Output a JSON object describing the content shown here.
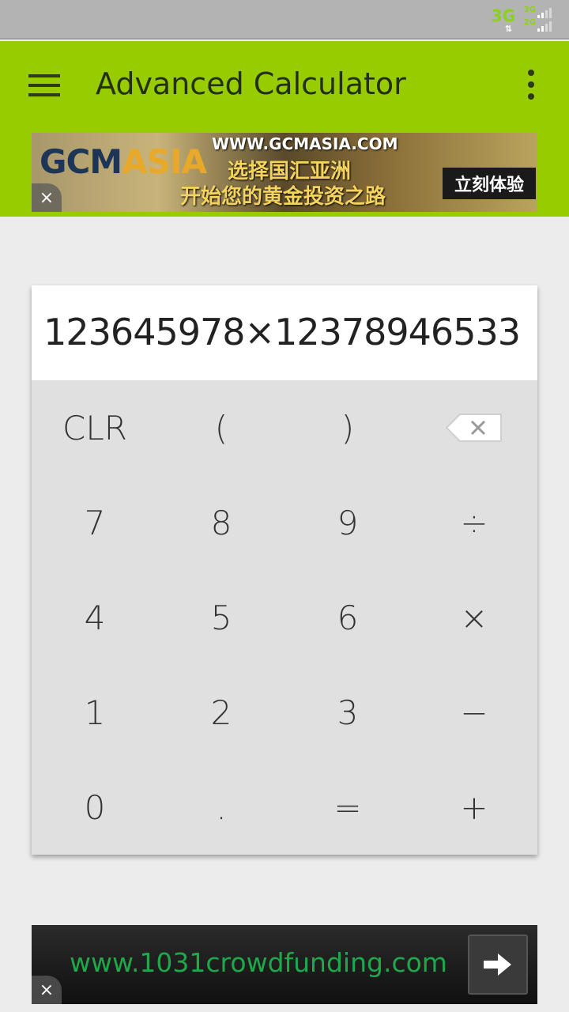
{
  "status_bar": {
    "network_main": "3G",
    "network_sub_top": "3G",
    "network_sub_bottom": "2G",
    "data_arrows": "⇅"
  },
  "app_bar": {
    "title": "Advanced Calculator",
    "menu_icon": "hamburger-menu-icon",
    "overflow_icon": "overflow-menu-icon"
  },
  "ad_top": {
    "logo_gcm": "GCM",
    "logo_asia": "ASIA",
    "url": "WWW.GCMASIA.COM",
    "line1": "选择国汇亚洲",
    "line2": "开始您的黄金投资之路",
    "cta": "立刻体验",
    "close": "×"
  },
  "calculator": {
    "display": "123645978×12378946533",
    "keys": [
      {
        "label": "CLR",
        "name": "clear-button"
      },
      {
        "label": "(",
        "name": "open-paren-button"
      },
      {
        "label": ")",
        "name": "close-paren-button"
      },
      {
        "label": "",
        "name": "backspace-button"
      },
      {
        "label": "7",
        "name": "digit-7-button"
      },
      {
        "label": "8",
        "name": "digit-8-button"
      },
      {
        "label": "9",
        "name": "digit-9-button"
      },
      {
        "label": "÷",
        "name": "divide-button"
      },
      {
        "label": "4",
        "name": "digit-4-button"
      },
      {
        "label": "5",
        "name": "digit-5-button"
      },
      {
        "label": "6",
        "name": "digit-6-button"
      },
      {
        "label": "×",
        "name": "multiply-button"
      },
      {
        "label": "1",
        "name": "digit-1-button"
      },
      {
        "label": "2",
        "name": "digit-2-button"
      },
      {
        "label": "3",
        "name": "digit-3-button"
      },
      {
        "label": "−",
        "name": "subtract-button"
      },
      {
        "label": "0",
        "name": "digit-0-button"
      },
      {
        "label": ".",
        "name": "decimal-button"
      },
      {
        "label": "=",
        "name": "equals-button"
      },
      {
        "label": "+",
        "name": "add-button"
      }
    ]
  },
  "ad_bottom": {
    "text": "www.1031crowdfunding.com",
    "close": "×",
    "arrow_icon": "arrow-right-icon"
  },
  "colors": {
    "app_bar": "#96cc00",
    "status_bar": "#b3b3b3",
    "background": "#ececec",
    "keypad": "#e0e0e0",
    "ad_bottom_text": "#1fa84a"
  }
}
